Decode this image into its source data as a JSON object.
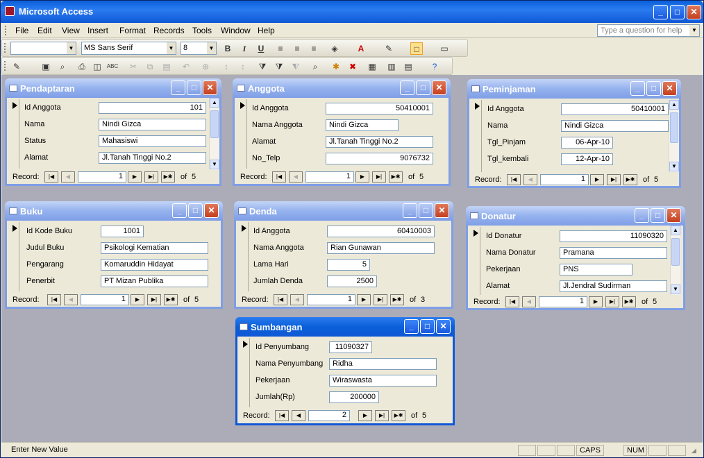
{
  "app": {
    "title": "Microsoft Access"
  },
  "menu": [
    "File",
    "Edit",
    "View",
    "Insert",
    "Format",
    "Records",
    "Tools",
    "Window",
    "Help"
  ],
  "help_placeholder": "Type a question for help",
  "format_toolbar": {
    "object": "",
    "font": "MS Sans Serif",
    "size": "8"
  },
  "status": {
    "text": "Enter New Value",
    "caps": "CAPS",
    "num": "NUM"
  },
  "nav": {
    "record_label": "Record:",
    "of": "of"
  },
  "forms": {
    "pendaptaran": {
      "title": "Pendaptaran",
      "fields": [
        {
          "label": "Id Anggota",
          "value": "101"
        },
        {
          "label": "Nama",
          "value": "Nindi Gizca"
        },
        {
          "label": "Status",
          "value": "Mahasiswi"
        },
        {
          "label": "Alamat",
          "value": "Jl.Tanah Tinggi No.2"
        }
      ],
      "record": "1",
      "total": "5"
    },
    "anggota": {
      "title": "Anggota",
      "fields": [
        {
          "label": "Id Anggota",
          "value": "50410001"
        },
        {
          "label": "Nama Anggota",
          "value": "Nindi Gizca"
        },
        {
          "label": "Alamat",
          "value": "Jl.Tanah Tinggi No.2"
        },
        {
          "label": "No_Telp",
          "value": "9076732"
        }
      ],
      "record": "1",
      "total": "5"
    },
    "peminjaman": {
      "title": "Peminjaman",
      "fields": [
        {
          "label": "Id Anggota",
          "value": "50410001"
        },
        {
          "label": "Nama",
          "value": "Nindi Gizca"
        },
        {
          "label": "Tgl_Pinjam",
          "value": "06-Apr-10"
        },
        {
          "label": "Tgl_kembali",
          "value": "12-Apr-10"
        }
      ],
      "record": "1",
      "total": "5"
    },
    "buku": {
      "title": "Buku",
      "fields": [
        {
          "label": "Id Kode Buku",
          "value": "1001"
        },
        {
          "label": "Judul Buku",
          "value": "Psikologi Kematian"
        },
        {
          "label": "Pengarang",
          "value": "Komaruddin Hidayat"
        },
        {
          "label": "Penerbit",
          "value": "PT Mizan Publika"
        }
      ],
      "record": "1",
      "total": "5"
    },
    "denda": {
      "title": "Denda",
      "fields": [
        {
          "label": "Id Anggota",
          "value": "60410003"
        },
        {
          "label": "Nama Anggota",
          "value": "Rian Gunawan"
        },
        {
          "label": "Lama Hari",
          "value": "5"
        },
        {
          "label": "Jumlah Denda",
          "value": "2500"
        }
      ],
      "record": "1",
      "total": "3"
    },
    "donatur": {
      "title": "Donatur",
      "fields": [
        {
          "label": "Id Donatur",
          "value": "11090320"
        },
        {
          "label": "Nama Donatur",
          "value": "Pramana"
        },
        {
          "label": "Pekerjaan",
          "value": "PNS"
        },
        {
          "label": "Alamat",
          "value": "Jl.Jendral Sudirman"
        }
      ],
      "record": "1",
      "total": "5"
    },
    "sumbangan": {
      "title": "Sumbangan",
      "fields": [
        {
          "label": "Id Penyumbang",
          "value": "11090327"
        },
        {
          "label": "Nama Penyumbang",
          "value": "Ridha"
        },
        {
          "label": "Pekerjaan",
          "value": "Wiraswasta"
        },
        {
          "label": "Jumlah(Rp)",
          "value": "200000"
        }
      ],
      "record": "2",
      "total": "5"
    }
  }
}
